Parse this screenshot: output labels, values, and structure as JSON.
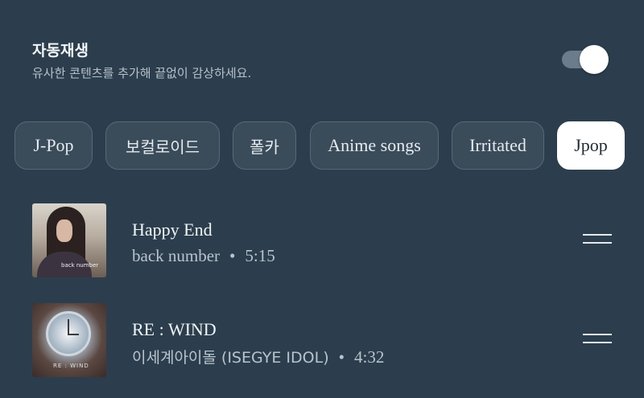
{
  "autoplay": {
    "title": "자동재생",
    "subtitle": "유사한 콘텐츠를 추가해 끝없이 감상하세요.",
    "enabled": true
  },
  "chips": [
    {
      "label": "J-Pop",
      "selected": false
    },
    {
      "label": "보컬로이드",
      "selected": false
    },
    {
      "label": "폴카",
      "selected": false
    },
    {
      "label": "Anime songs",
      "selected": false
    },
    {
      "label": "Irritated",
      "selected": false
    },
    {
      "label": "Jpop",
      "selected": true
    }
  ],
  "tracks": [
    {
      "title": "Happy End",
      "artist": "back number",
      "separator": "•",
      "duration": "5:15",
      "album_caption": "back number"
    },
    {
      "title": "RE : WIND",
      "artist": "이세계아이돌 (ISEGYE IDOL)",
      "separator": "•",
      "duration": "4:32",
      "album_caption": "RE : WIND"
    }
  ],
  "colors": {
    "background": "#2c3e4d",
    "chip": "#3a4c5a",
    "chip_selected": "#ffffff",
    "toggle_knob": "#ffffff"
  },
  "icons": {
    "drag_handle": "drag-handle-icon"
  }
}
